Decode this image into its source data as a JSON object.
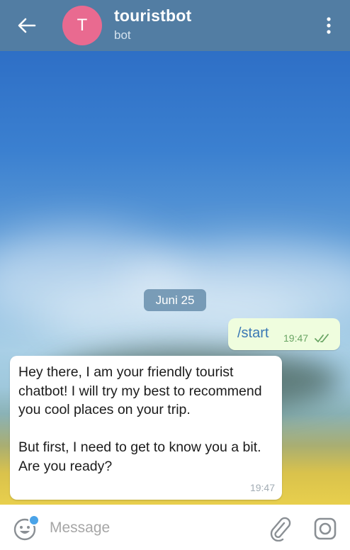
{
  "header": {
    "avatar_letter": "T",
    "title": "touristbot",
    "subtitle": "bot"
  },
  "chat": {
    "date_label": "Juni 25",
    "outgoing": {
      "text": "/start",
      "time": "19:47",
      "status_icon": "double-check-icon"
    },
    "incoming": {
      "paragraph_1": "Hey there, I am your friendly tourist chatbot! I will try my best to recommend you cool places on your trip.",
      "paragraph_2": "But first, I need to get to know you a bit. Are you ready?",
      "time": "19:47"
    }
  },
  "input_bar": {
    "placeholder": "Message",
    "icons": [
      "emoji-icon",
      "paperclip-icon",
      "camera-icon"
    ]
  },
  "colors": {
    "header_bg": "#527da3",
    "avatar_bg": "#e96a90",
    "outgoing_bubble": "#effdde",
    "link_blue": "#3a78b5",
    "check_green": "#6aa564"
  }
}
